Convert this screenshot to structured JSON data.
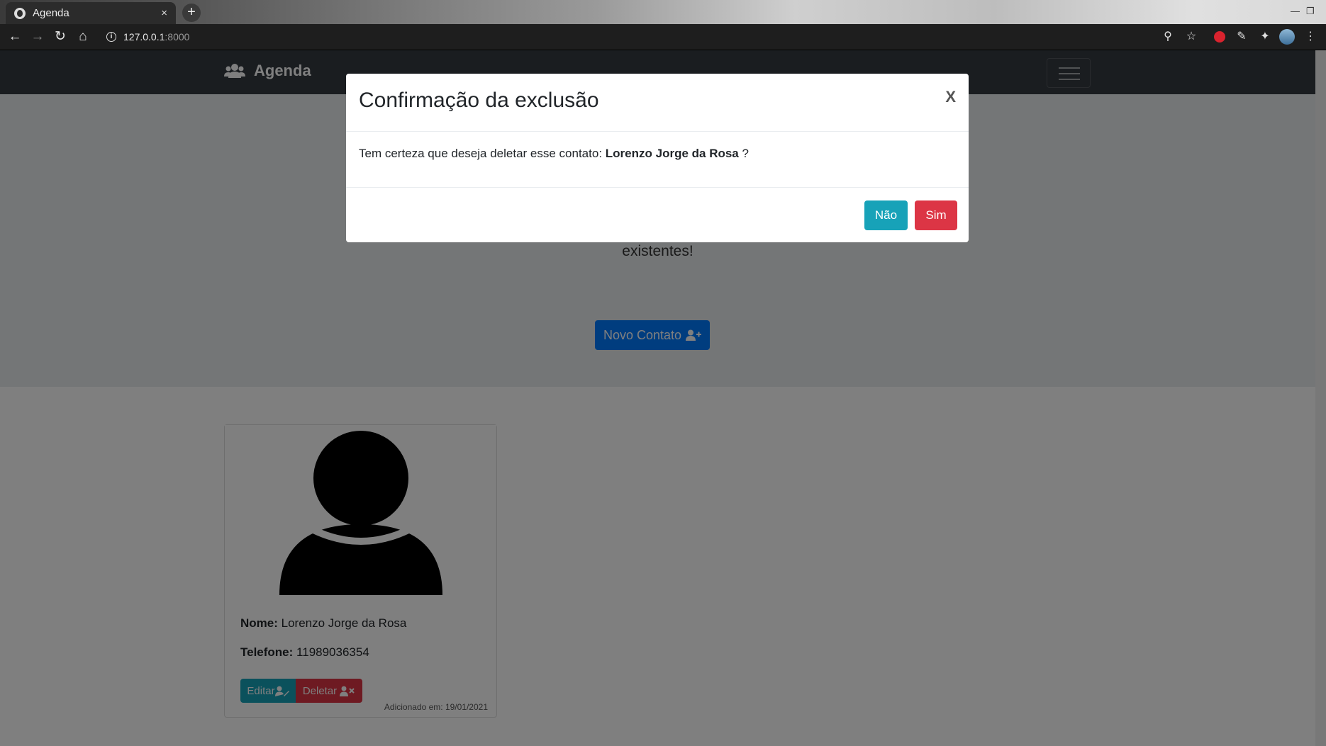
{
  "browser": {
    "tab_title": "Agenda",
    "tab_close": "×",
    "new_tab": "+",
    "url_host": "127.0.0.1",
    "url_port": ":8000"
  },
  "navbar": {
    "brand": "Agenda"
  },
  "jumbotron": {
    "subtitle_visible": "existentes!",
    "new_contact_label": "Novo Contato"
  },
  "contact_card": {
    "name_label": "Nome:",
    "name_value": "Lorenzo Jorge da Rosa",
    "phone_label": "Telefone:",
    "phone_value": "11989036354",
    "edit_label": "Editar",
    "delete_label": "Deletar",
    "added_text": "Adicionado em: 19/01/2021"
  },
  "modal": {
    "title": "Confirmação da exclusão",
    "close": "X",
    "body_prefix": "Tem certeza que deseja deletar esse contato:",
    "contact_name": "Lorenzo Jorge da Rosa",
    "body_suffix": "?",
    "no_label": "Não",
    "yes_label": "Sim"
  },
  "colors": {
    "primary": "#007bff",
    "info": "#17a2b8",
    "danger": "#dc3545",
    "navbar": "#343a40"
  }
}
